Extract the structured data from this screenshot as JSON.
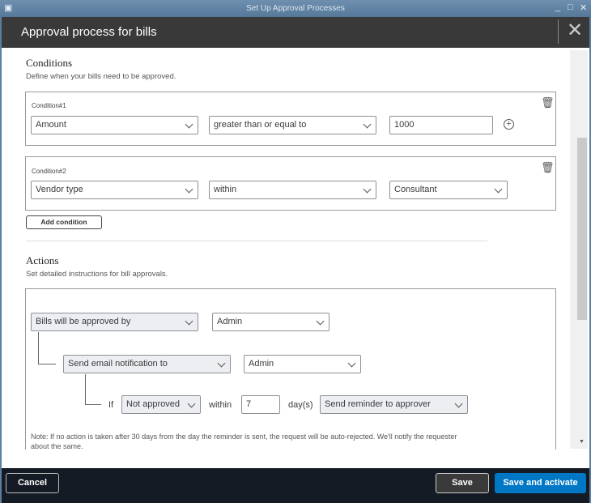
{
  "window": {
    "title": "Set Up Approval Processes"
  },
  "header": {
    "title": "Approval process for bills"
  },
  "conditions": {
    "heading": "Conditions",
    "description": "Define when your bills need to be approved.",
    "items": [
      {
        "label": "Condition#1",
        "field": "Amount",
        "operator": "greater than or equal to",
        "value": "1000"
      },
      {
        "label": "Condition#2",
        "field": "Vendor type",
        "operator": "within",
        "value": "Consultant"
      }
    ],
    "add_label": "Add condition"
  },
  "actions": {
    "heading": "Actions",
    "description": "Set detailed instructions for bill approvals.",
    "approved_by": "Bills will be approved by",
    "approver": "Admin",
    "notify": "Send email notification to",
    "notify_to": "Admin",
    "if_label": "If",
    "status": "Not approved",
    "within_label": "within",
    "days": "7",
    "days_label": "day(s)",
    "reminder": "Send reminder to approver",
    "note": "Note: If no action is taken after 30 days from the day the reminder is sent, the request will be auto-rejected. We'll notify the requester about the same."
  },
  "footer": {
    "cancel": "Cancel",
    "save": "Save",
    "save_activate": "Save and activate"
  },
  "colors": {
    "primary": "#0077c5",
    "header": "#393939",
    "footer": "#141b24"
  }
}
